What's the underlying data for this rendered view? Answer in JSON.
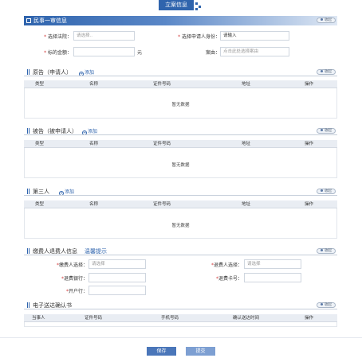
{
  "page": {
    "tab_label": "立案信息",
    "section_title": "民事一审信息",
    "collapse_label": "收起"
  },
  "case_form": {
    "court": {
      "label": "选择法院：",
      "placeholder": "请选择.."
    },
    "applicant_role": {
      "label": "选择申请人身份：",
      "placeholder": "请输入"
    },
    "amount": {
      "label": "标的金额：",
      "value": "",
      "unit": "元"
    },
    "cause": {
      "label": "案由：",
      "placeholder": "点击此处选择案由"
    }
  },
  "plaintiff": {
    "title": "原告（申请人）",
    "add_label": "添加",
    "columns": [
      "类型",
      "名称",
      "证件号码",
      "地址",
      "操作"
    ],
    "empty_text": "暂无数据"
  },
  "defendant": {
    "title": "被告（被申请人）",
    "add_label": "添加",
    "columns": [
      "类型",
      "名称",
      "证件号码",
      "地址",
      "操作"
    ],
    "empty_text": "暂无数据"
  },
  "third_party": {
    "title": "第三人",
    "add_label": "添加",
    "columns": [
      "类型",
      "名称",
      "证件号码",
      "地址",
      "操作"
    ],
    "empty_text": "暂无数据"
  },
  "payer": {
    "title": "缴费人退费人信息",
    "hint_label": "温馨提示",
    "payer_label": "缴费人选择：",
    "payer_placeholder": "请选择",
    "refund_label": "退费人选择：",
    "refund_placeholder": "请选择",
    "refund_bank_label": "退费银行：",
    "refund_account_label": "退费卡号：",
    "account_holder_label": "开户行："
  },
  "service": {
    "title": "电子送达确认书",
    "columns": [
      "当事人",
      "证件号码",
      "手机号码",
      "确认送达时间",
      "操作"
    ]
  },
  "actions": {
    "save_label": "保存",
    "submit_label": "提交"
  },
  "colors": {
    "primary": "#2f64ad",
    "required": "#d23c3c"
  }
}
